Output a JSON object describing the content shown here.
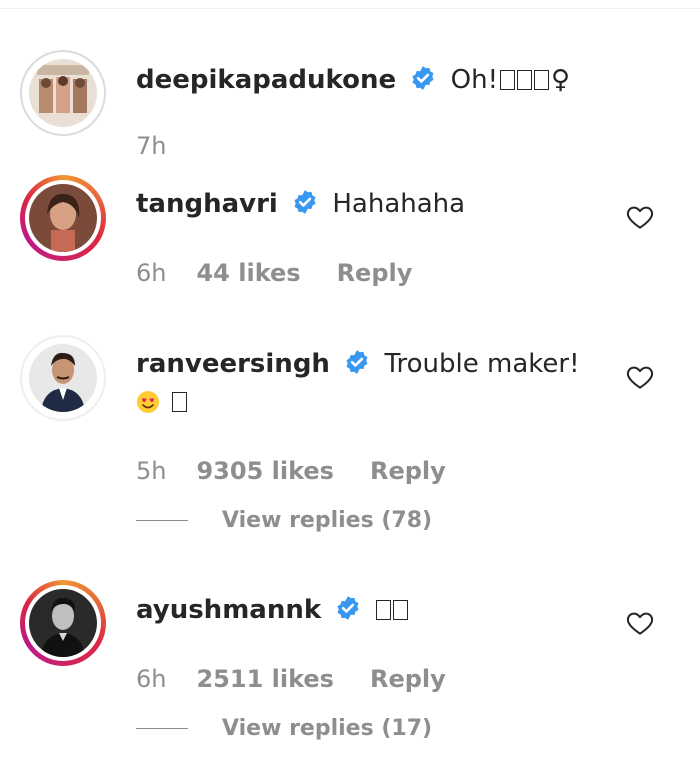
{
  "comments": [
    {
      "username": "deepikapadukone",
      "text": "Oh!",
      "time": "7h",
      "likes": "",
      "reply": "",
      "view_replies": ""
    },
    {
      "username": "tanghavri",
      "text": "Hahahaha",
      "time": "6h",
      "likes": "44 likes",
      "reply": "Reply",
      "view_replies": ""
    },
    {
      "username": "ranveersingh",
      "text": "Trouble maker!",
      "time": "5h",
      "likes": "9305 likes",
      "reply": "Reply",
      "view_replies": "View replies (78)"
    },
    {
      "username": "ayushmannk",
      "text": "",
      "time": "6h",
      "likes": "2511 likes",
      "reply": "Reply",
      "view_replies": "View replies (17)"
    }
  ],
  "icons": {
    "verified": "verified-badge-icon",
    "like": "heart-icon",
    "emoji": "heart-eyes-emoji"
  },
  "colors": {
    "verified_blue": "#3897f0",
    "muted_text": "#8e8e8e",
    "story_ring_start": "#f09433",
    "story_ring_end": "#bc1888"
  }
}
